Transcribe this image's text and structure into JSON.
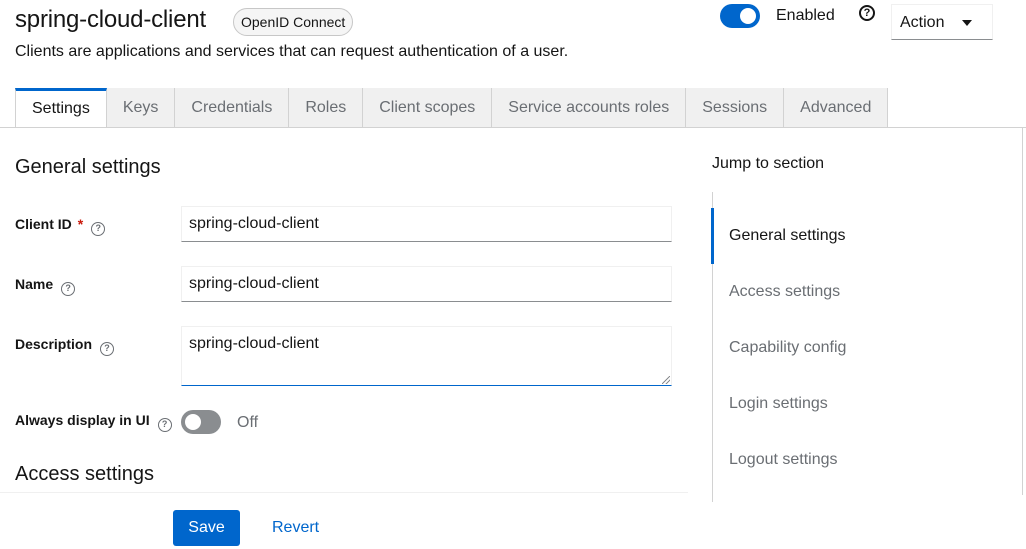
{
  "header": {
    "title": "spring-cloud-client",
    "protocol_badge": "OpenID Connect",
    "subtitle": "Clients are applications and services that can request authentication of a user.",
    "enabled_label": "Enabled",
    "help_icon": "?",
    "action_label": "Action"
  },
  "tabs": [
    {
      "label": "Settings",
      "active": true
    },
    {
      "label": "Keys"
    },
    {
      "label": "Credentials"
    },
    {
      "label": "Roles"
    },
    {
      "label": "Client scopes"
    },
    {
      "label": "Service accounts roles"
    },
    {
      "label": "Sessions"
    },
    {
      "label": "Advanced"
    }
  ],
  "general": {
    "title": "General settings",
    "client_id_label": "Client ID",
    "required_mark": "*",
    "client_id_value": "spring-cloud-client",
    "name_label": "Name",
    "name_value": "spring-cloud-client",
    "description_label": "Description",
    "description_value": "spring-cloud-client",
    "always_display_label": "Always display in UI",
    "always_display_state": "Off",
    "help_mark": "?"
  },
  "access": {
    "title": "Access settings"
  },
  "footer": {
    "save_label": "Save",
    "revert_label": "Revert"
  },
  "jump": {
    "title": "Jump to section",
    "items": [
      {
        "label": "General settings",
        "active": true
      },
      {
        "label": "Access settings"
      },
      {
        "label": "Capability config"
      },
      {
        "label": "Login settings"
      },
      {
        "label": "Logout settings"
      }
    ]
  },
  "colors": {
    "accent": "#0066cc",
    "required": "#c9190b",
    "muted": "#6a6e73"
  }
}
